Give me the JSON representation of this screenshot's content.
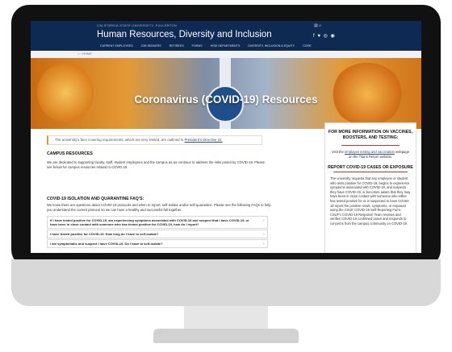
{
  "header": {
    "university": "CALIFORNIA STATE UNIVERSITY, FULLERTON",
    "title": "Human Resources, Diversity and Inclusion",
    "utility_icons": "▤ ⌕",
    "social_icons": "f ♥ ◎ ◉"
  },
  "nav": [
    "CURRENT EMPLOYEES",
    "JOB SEEKERS",
    "RETIREES",
    "FORMS",
    "HRDI DEPARTMENTS",
    "DIVERSITY, INCLUSION & EQUITY",
    "CORE"
  ],
  "breadcrumb": "⌂ › HOME",
  "hero": {
    "title": "Coronavirus (COVID-19) Resources"
  },
  "notice": {
    "text": "The university's face covering requirements, which are very limited, are outlined in",
    "link": "President's Directive 22."
  },
  "campus": {
    "heading": "CAMPUS RESOURCES",
    "body": "We are dedicated to supporting faculty, staff, student employees and the campus as we continue to address the risks posed by COVID-19. Please see below for campus resources related to COVID-19."
  },
  "faq": {
    "heading": "COVID-19 ISOLATION AND QUARANTINE FAQ'S:",
    "body": "We know there are questions about COVID-19 protocols and when to report, self-isolate and/or self-quarantine. Please see the following FAQs to help you understand the current protocol so we can have a healthy and successful fall together.",
    "items": [
      "If I have tested positive for COVID-19, am experiencing symptoms associated with COVID-19 and suspect that I have COVID-19, or have been in close contact with someone who has tested positive for COVID-19, how do I report?",
      "I have tested positive for COVID-19. How long do I have to self-isolate?",
      "I am symptomatic and suspect I have COVID-19. Do I have to self-isolate?"
    ],
    "expand_icon": "+"
  },
  "sidebar": {
    "heading1": "FOR MORE INFORMATION ON VACCINES, BOOSTERS, AND TESTING:",
    "text1_pre": "Visit the",
    "text1_link": "employee testing and vaccination",
    "text1_post": "webpage on the Titans Return website.",
    "heading2": "REPORT COVID-19 CASES OR EXPOSURE",
    "text2": "The university requests that any employee or student who tests positive for COVID-19, begins to experience symptoms associated with COVID-19, and suspects they have COVID-19, or becomes aware that they may have been in close contact with someone who either has tested positive for or is suspected to have COVID-19 report the positive result, symptoms, or exposure using the CSUF COVID-19 Self-Reporting Form. CSUF's COVID-19 Response Team reviews and verifies COVID-19 confirmed cases and responds to concerns from the campus community on COVID-19."
  }
}
